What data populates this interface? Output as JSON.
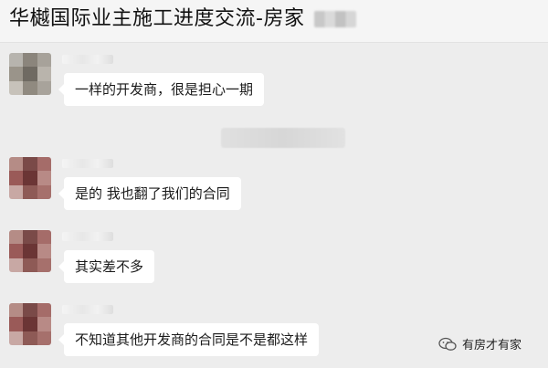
{
  "header": {
    "title": "华樾国际业主施工进度交流-房家"
  },
  "messages": [
    {
      "text": "一样的开发商，很是担心一期"
    },
    {
      "text": "是的 我也翻了我们的合同"
    },
    {
      "text": "其实差不多"
    },
    {
      "text": "不知道其他开发商的合同是不是都这样"
    }
  ],
  "watermark": {
    "text": "有房才有家",
    "icon": "wechat-icon"
  },
  "colors": {
    "background": "#ededed",
    "bubble": "#ffffff",
    "text": "#1a1a1a"
  }
}
